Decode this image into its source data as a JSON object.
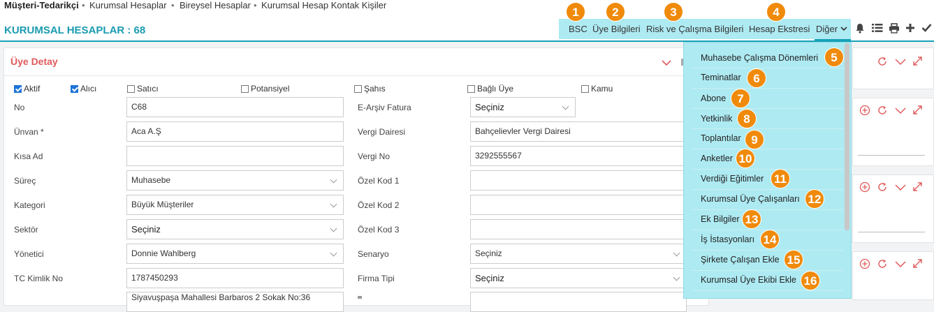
{
  "breadcrumb": {
    "items": [
      "Müşteri-Tedarikçi",
      "Kurumsal Hesaplar",
      "Bireysel Hesaplar",
      "Kurumsal Hesap Kontak Kişiler"
    ]
  },
  "header": {
    "title": "KURUMSAL HESAPLAR : 68",
    "tabs": [
      "BSC",
      "Üye Bilgileri",
      "Risk ve Çalışma Bilgileri",
      "Hesap Ekstresi",
      "Diğer"
    ],
    "icons": [
      "bell-icon",
      "list-icon",
      "print-icon",
      "plus-icon",
      "check-icon"
    ]
  },
  "badges": [
    "1",
    "2",
    "3",
    "4",
    "5",
    "6",
    "7",
    "8",
    "9",
    "10",
    "11",
    "12",
    "13",
    "14",
    "15",
    "16"
  ],
  "card": {
    "title": "Üye Detay",
    "checkboxes": [
      {
        "label": "Aktif",
        "checked": true
      },
      {
        "label": "Alıcı",
        "checked": true
      },
      {
        "label": "Satıcı",
        "checked": false
      },
      {
        "label": "Potansiyel",
        "checked": false
      },
      {
        "label": "Şahıs",
        "checked": false
      },
      {
        "label": "Bağlı Üye",
        "checked": false
      },
      {
        "label": "Kamu",
        "checked": false
      }
    ],
    "left_fields": [
      {
        "label": "No",
        "value": "C68"
      },
      {
        "label": "Ünvan *",
        "value": "Aca A.Ş"
      },
      {
        "label": "Kısa Ad",
        "value": ""
      },
      {
        "label": "Süreç",
        "value": "Muhasebe"
      },
      {
        "label": "Kategori",
        "value": "Büyük Müşteriler"
      },
      {
        "label": "Sektör",
        "value": "Seçiniz"
      },
      {
        "label": "Yönetici",
        "value": "Donnie Wahlberg"
      },
      {
        "label": "TC Kimlik No",
        "value": "1787450293"
      },
      {
        "label": "",
        "value": "Siyavuşpaşa Mahallesi Barbaros 2 Sokak No:36"
      }
    ],
    "right_fields": [
      {
        "label": "E-Arşiv Fatura",
        "value": "Seçiniz"
      },
      {
        "label": "Vergi Dairesi",
        "value": "Bahçelievler Vergi Dairesi"
      },
      {
        "label": "Vergi No",
        "value": "3292555567"
      },
      {
        "label": "Özel Kod 1",
        "value": ""
      },
      {
        "label": "Özel Kod 2",
        "value": ""
      },
      {
        "label": "Özel Kod 3",
        "value": ""
      },
      {
        "label": "Senaryo",
        "value": "Seçiniz"
      },
      {
        "label": "Firma Tipi",
        "value": "Seçiniz"
      }
    ]
  },
  "menu": {
    "items": [
      "Muhasebe Çalışma Dönemleri",
      "Teminatlar",
      "Abone",
      "Yetkinlik",
      "Toplantılar",
      "Anketler",
      "Verdiği Eğitimler",
      "Kurumsal Üye Çalışanları",
      "Ek Bilgiler",
      "İş İstasyonları",
      "Şirkete Çalışan Ekle",
      "Kurumsal Üye Ekibi Ekle"
    ]
  },
  "colors": {
    "accent": "#17a2b8",
    "badge": "#f08a0a",
    "highlight": "#aeeaf2",
    "card_title": "#e05a5a"
  }
}
